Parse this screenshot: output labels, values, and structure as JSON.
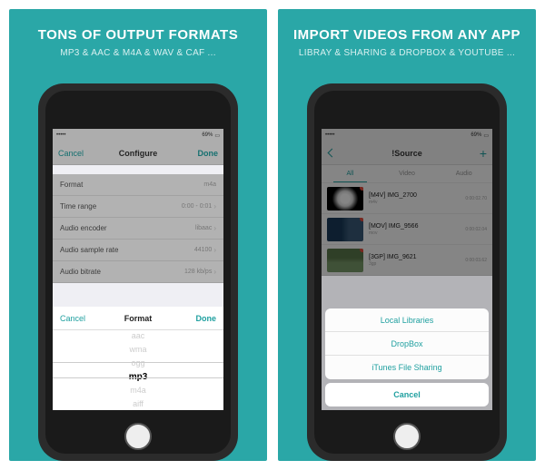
{
  "panels": {
    "left": {
      "headline": "TONS OF OUTPUT FORMATS",
      "subhead": "MP3 & AAC & M4A & WAV & CAF ..."
    },
    "right": {
      "headline": "IMPORT VIDEOS FROM ANY APP",
      "subhead": "LIBRAY & SHARING & DROPBOX & YOUTUBE ..."
    }
  },
  "statusbar": {
    "carrier": "•••••",
    "wifi": "⌄",
    "time": " ",
    "battery_pct": "69%",
    "bt": "✱"
  },
  "configure": {
    "nav_cancel": "Cancel",
    "nav_title": "Configure",
    "nav_done": "Done",
    "rows": [
      {
        "label": "Format",
        "value": "m4a"
      },
      {
        "label": "Time range",
        "value": "0:00 - 0:01"
      },
      {
        "label": "Audio encoder",
        "value": "libaac"
      },
      {
        "label": "Audio sample rate",
        "value": "44100"
      },
      {
        "label": "Audio bitrate",
        "value": "128 kb/ps"
      }
    ],
    "picker": {
      "cancel": "Cancel",
      "title": "Format",
      "done": "Done",
      "options": [
        "aac",
        "wma",
        "ogg",
        "mp3",
        "m4a",
        "aiff"
      ],
      "selected": "mp3"
    }
  },
  "source": {
    "nav_title": "!Source",
    "nav_plus": "+",
    "tabs": [
      {
        "label": "All",
        "active": true
      },
      {
        "label": "Video",
        "active": false
      },
      {
        "label": "Audio",
        "active": false
      }
    ],
    "items": [
      {
        "title": "[M4V] IMG_2700",
        "sub": "m4v",
        "time": "0:00:02.70"
      },
      {
        "title": "[MOV] IMG_9566",
        "sub": "mov",
        "time": "0:00:02.04"
      },
      {
        "title": "[3GP] IMG_9621",
        "sub": "3gp",
        "time": "0:00:03.62"
      }
    ],
    "sheet": {
      "items": [
        "Local Libraries",
        "DropBox",
        "iTunes File Sharing"
      ],
      "cancel": "Cancel"
    }
  }
}
